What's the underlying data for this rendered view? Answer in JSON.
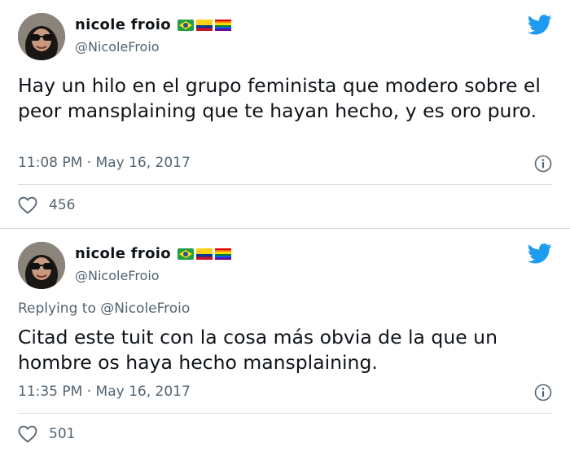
{
  "tweets": [
    {
      "author": {
        "name": "nicole froio",
        "handle": "@NicoleFroio"
      },
      "reply_prefix": "",
      "reply_handle": "",
      "text": "Hay un hilo en el grupo feminista que modero sobre el peor mansplaining que te hayan hecho, y es oro puro.",
      "timestamp": "11:08 PM · May 16, 2017",
      "likes": "456"
    },
    {
      "author": {
        "name": "nicole froio",
        "handle": "@NicoleFroio"
      },
      "reply_prefix": "Replying to",
      "reply_handle": "@NicoleFroio",
      "text": "Citad este tuit con la cosa más obvia de la que un hombre os haya hecho mansplaining.",
      "timestamp": "11:35 PM · May 16, 2017",
      "likes": "501"
    }
  ],
  "colors": {
    "twitter_blue": "#1d9bf0",
    "text_secondary": "#536471",
    "divider": "#d6dbde"
  },
  "icons": [
    "twitter-bird-icon",
    "info-icon",
    "heart-icon",
    "flag-brazil-icon",
    "flag-colombia-icon",
    "flag-rainbow-icon"
  ]
}
